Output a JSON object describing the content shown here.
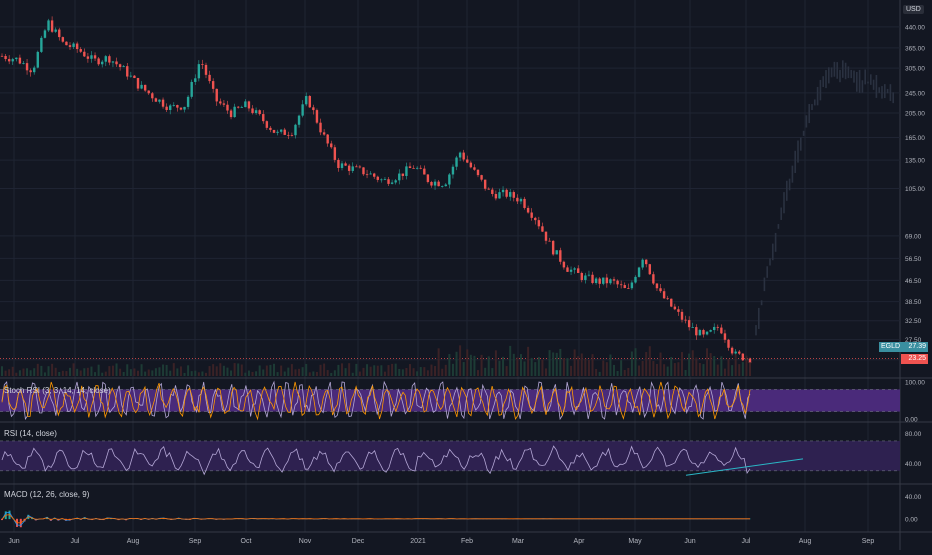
{
  "currency": "USD",
  "price_tags": {
    "ticker": "EGLD",
    "value_high": "27.39",
    "value_last": "23.25"
  },
  "colors": {
    "background": "#131722",
    "grid": "#1f2433",
    "up": "#26a69a",
    "down": "#ef5350",
    "stoch_band": "#4a2a7a",
    "rsi_band": "#2e2150",
    "indicator_line": "#b4a7d6",
    "macd_line": "#2196f3",
    "signal_line": "#ff6d00",
    "trendline": "#2ab7c6",
    "tag_ticker": "#3a8fa0",
    "tag_last": "#ef5350"
  },
  "chart_data": [
    {
      "type": "candlestick",
      "name": "price",
      "scale": "log",
      "y_ticks": [
        "440.00",
        "365.00",
        "305.00",
        "245.00",
        "205.00",
        "165.00",
        "135.00",
        "105.00",
        "69.00",
        "56.50",
        "46.50",
        "38.50",
        "32.50",
        "27.50",
        "23.00"
      ],
      "x_ticks": [
        "Jun",
        "Jul",
        "Aug",
        "Sep",
        "Oct",
        "Nov",
        "Dec",
        "2021",
        "Feb",
        "Mar",
        "Apr",
        "May",
        "Jun",
        "Jul",
        "Aug",
        "Sep"
      ],
      "close_path": [
        [
          "Jun",
          340
        ],
        [
          "Jun",
          330
        ],
        [
          "Jun",
          300
        ],
        [
          "Jun",
          460
        ],
        [
          "Jun",
          380
        ],
        [
          "Jun",
          360
        ],
        [
          "Jul",
          325
        ],
        [
          "Jul",
          335
        ],
        [
          "Jul",
          300
        ],
        [
          "Aug",
          260
        ],
        [
          "Aug",
          235
        ],
        [
          "Aug",
          215
        ],
        [
          "Sep",
          220
        ],
        [
          "Sep",
          330
        ],
        [
          "Sep",
          230
        ],
        [
          "Sep",
          205
        ],
        [
          "Oct",
          220
        ],
        [
          "Oct",
          195
        ],
        [
          "Oct",
          170
        ],
        [
          "Oct",
          175
        ],
        [
          "Nov",
          235
        ],
        [
          "Nov",
          170
        ],
        [
          "Nov",
          130
        ],
        [
          "Nov",
          125
        ],
        [
          "Dec",
          120
        ],
        [
          "Dec",
          112
        ],
        [
          "Dec",
          118
        ],
        [
          "2021",
          128
        ],
        [
          "2021",
          112
        ],
        [
          "2021",
          110
        ],
        [
          "Feb",
          145
        ],
        [
          "Feb",
          120
        ],
        [
          "Feb",
          100
        ],
        [
          "Feb",
          100
        ],
        [
          "Mar",
          95
        ],
        [
          "Mar",
          80
        ],
        [
          "Mar",
          62
        ],
        [
          "Apr",
          52
        ],
        [
          "Apr",
          48
        ],
        [
          "Apr",
          46
        ],
        [
          "May",
          46
        ],
        [
          "May",
          42
        ],
        [
          "May",
          58
        ],
        [
          "May",
          42
        ],
        [
          "Jun",
          36
        ],
        [
          "Jun",
          31
        ],
        [
          "Jun",
          28
        ],
        [
          "Jun",
          31
        ],
        [
          "Jun",
          24
        ],
        [
          "Jul",
          23.25
        ]
      ],
      "projection_note_absent": true
    },
    {
      "type": "line",
      "name": "Stoch RSI (3, 3, 14, 14, close)",
      "y_ticks": [
        "100.00",
        "0.00"
      ],
      "band": [
        20,
        80
      ]
    },
    {
      "type": "line",
      "name": "RSI (14, close)",
      "y_ticks": [
        "80.00",
        "40.00"
      ],
      "band": [
        30,
        70
      ]
    },
    {
      "type": "line",
      "name": "MACD (12, 26, close, 9)",
      "y_ticks": [
        "40.00",
        "0.00"
      ]
    }
  ],
  "legends": {
    "stoch": "Stoch RSI (3, 3, 14, 14, close)",
    "rsi": "RSI (14, close)",
    "macd": "MACD (12, 26, close, 9)"
  }
}
